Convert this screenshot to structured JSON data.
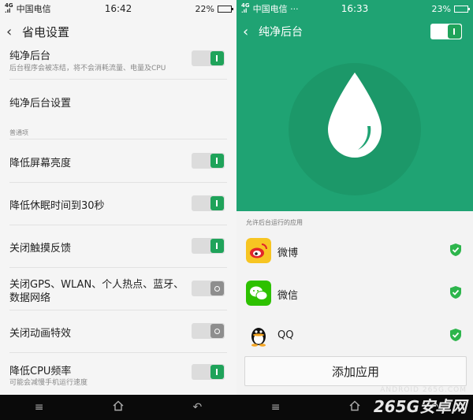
{
  "left": {
    "status": {
      "carrier": "中国电信",
      "time": "16:42",
      "battery": "22%",
      "battery_fraction": 0.22
    },
    "header": {
      "title": "省电设置"
    },
    "items": {
      "pure_bg": {
        "title": "纯净后台",
        "subtitle": "后台程序会被冻结，将不会消耗流量、电量及CPU",
        "on": true
      },
      "pure_bg_settings": {
        "title": "纯净后台设置"
      },
      "section_general": "普通项",
      "lower_brightness": {
        "title": "降低屏幕亮度",
        "on": true
      },
      "sleep_30s": {
        "title": "降低休眠时间到30秒",
        "on": true
      },
      "haptic": {
        "title": "关闭触摸反馈",
        "on": true
      },
      "radios": {
        "title_line1": "关闭GPS、WLAN、个人热点、蓝牙、",
        "title_line2": "数据网络",
        "on": false
      },
      "animation": {
        "title": "关闭动画特效",
        "on": false
      },
      "cpu": {
        "title": "降低CPU频率",
        "subtitle": "可能会减慢手机运行速度",
        "on": true
      }
    }
  },
  "right": {
    "status": {
      "carrier": "中国电信 ···",
      "time": "16:33",
      "battery": "23%",
      "battery_fraction": 0.23
    },
    "header": {
      "title": "纯净后台",
      "on": true
    },
    "allow_label": "允许后台运行的应用",
    "apps": [
      {
        "name": "微博",
        "icon": "weibo-icon"
      },
      {
        "name": "微信",
        "icon": "wechat-icon"
      },
      {
        "name": "QQ",
        "icon": "qq-icon"
      }
    ],
    "add_button": "添加应用"
  },
  "watermark": {
    "line1": "ANDROID 265G.COM",
    "line2": "265G安卓网"
  },
  "colors": {
    "accent": "#1fa35a",
    "hero": "#1fa373"
  }
}
